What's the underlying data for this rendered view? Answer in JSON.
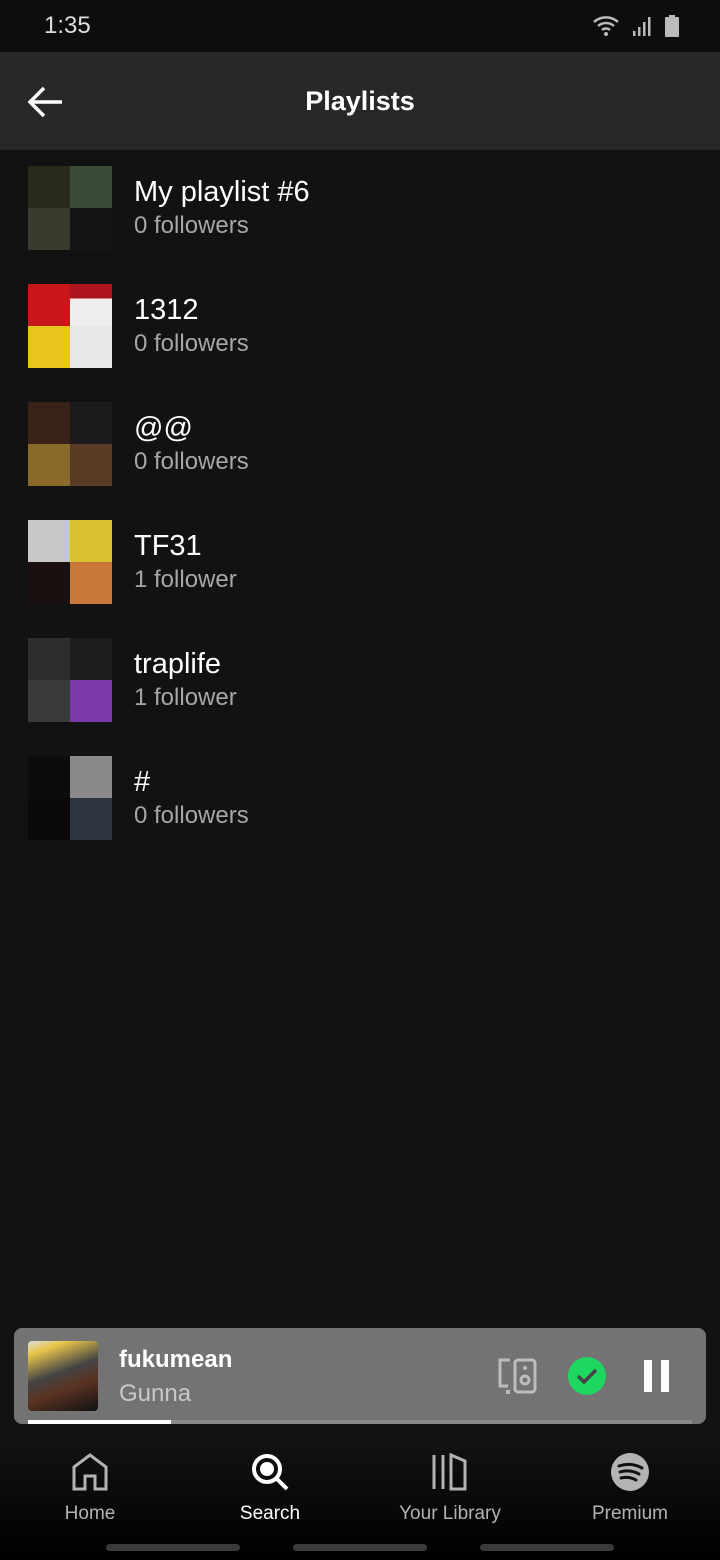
{
  "status_bar": {
    "time": "1:35",
    "icons": [
      "wifi-icon",
      "signal-icon",
      "battery-icon"
    ]
  },
  "header": {
    "title": "Playlists",
    "back_icon": "arrow-left-icon"
  },
  "playlists": [
    {
      "name": "My playlist #6",
      "followers": "0 followers"
    },
    {
      "name": "1312",
      "followers": "0 followers"
    },
    {
      "name": "@@",
      "followers": "0 followers"
    },
    {
      "name": "TF31",
      "followers": "1 follower"
    },
    {
      "name": "traplife",
      "followers": "1 follower"
    },
    {
      "name": "#",
      "followers": "0 followers"
    }
  ],
  "now_playing": {
    "title": "fukumean",
    "artist": "Gunna",
    "progress": 0.215,
    "accent": "#1ed760"
  },
  "nav": [
    {
      "label": "Home"
    },
    {
      "label": "Search"
    },
    {
      "label": "Your Library"
    },
    {
      "label": "Premium"
    }
  ]
}
